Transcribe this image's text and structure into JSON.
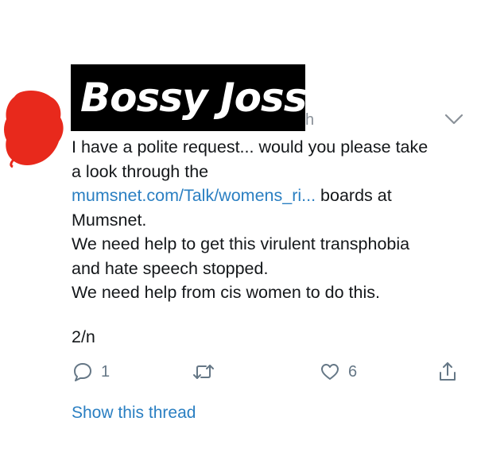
{
  "tweet": {
    "author_name_overlay": "Bossy Joss",
    "handle_fragment": "h",
    "text_lines": [
      {
        "text": "I have a polite request... would you please take"
      },
      {
        "text": "a look through the"
      },
      {
        "link": "mumsnet.com/Talk/womens_ri...",
        "text": " boards at"
      },
      {
        "text": "Mumsnet."
      },
      {
        "text": "We need help to get this virulent transphobia"
      },
      {
        "text": "and hate speech stopped."
      },
      {
        "text": "We need help from cis women to do this."
      }
    ],
    "thread_count": "2/n",
    "show_thread_label": "Show this thread"
  },
  "actions": {
    "reply_count": "1",
    "like_count": "6",
    "icons": [
      "reply-icon",
      "retweet-icon",
      "like-icon",
      "share-icon"
    ]
  },
  "colors": {
    "link": "#2a7fc2",
    "icon_gray": "#657786",
    "redaction_red": "#e8291c",
    "banner_black": "#000000"
  }
}
